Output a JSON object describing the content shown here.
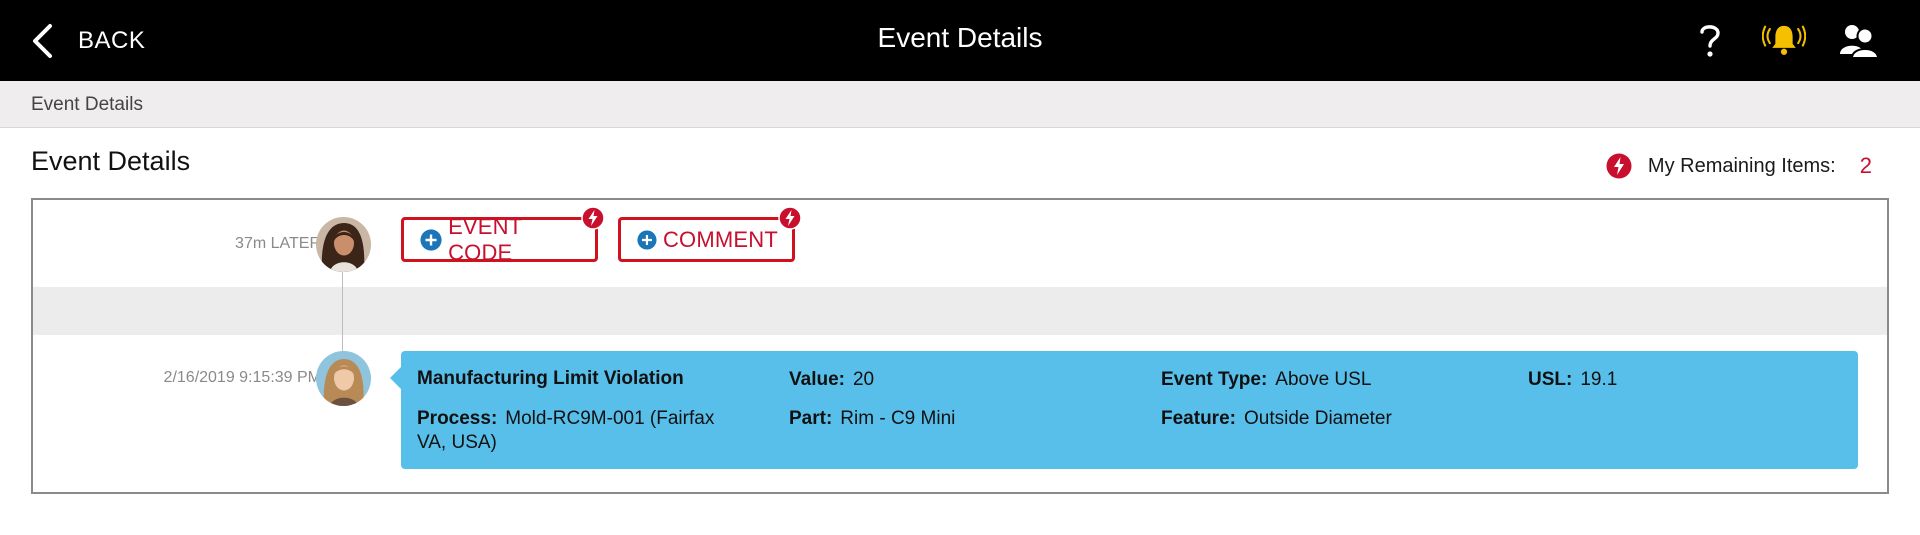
{
  "header": {
    "back_label": "BACK",
    "title": "Event Details",
    "icons": [
      "help-icon",
      "alarm-bell-icon",
      "users-icon"
    ],
    "bell_color": "#f5c000"
  },
  "breadcrumb": {
    "label": "Event Details"
  },
  "page": {
    "title": "Event Details",
    "remaining_label": "My Remaining Items:",
    "remaining_count": "2",
    "accent_red": "#c8102e"
  },
  "timeline": {
    "entries": [
      {
        "timestamp": "37m LATER",
        "actions": [
          {
            "label": "EVENT CODE",
            "icon": "plus-circle-icon"
          },
          {
            "label": "COMMENT",
            "icon": "plus-circle-icon"
          }
        ]
      },
      {
        "timestamp": "2/16/2019 9:15:39 PM",
        "event": {
          "title": "Manufacturing Limit Violation",
          "value_label": "Value:",
          "value": "20",
          "event_type_label": "Event Type:",
          "event_type": "Above USL",
          "usl_label": "USL:",
          "usl": "19.1",
          "process_label": "Process:",
          "process": "Mold-RC9M-001 (Fairfax VA, USA)",
          "part_label": "Part:",
          "part": "Rim - C9 Mini",
          "feature_label": "Feature:",
          "feature": "Outside Diameter",
          "card_color": "#57bfea"
        }
      }
    ]
  }
}
